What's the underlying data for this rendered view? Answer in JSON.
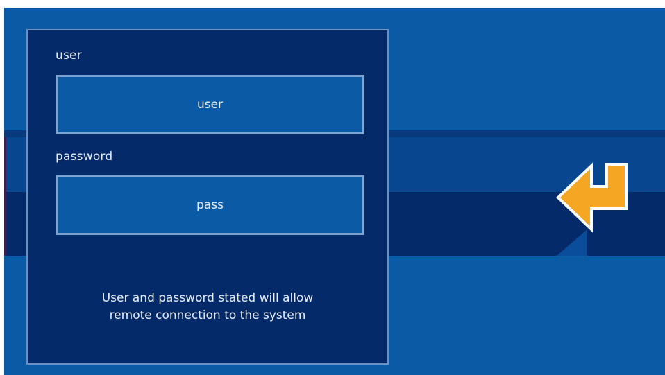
{
  "login_panel": {
    "user_label": "user",
    "user_value": "user",
    "password_label": "password",
    "password_value": "pass",
    "notice_line1": "User and password stated will allow",
    "notice_line2": "remote connection to the system"
  },
  "enter_button": {
    "icon": "enter-arrow-icon",
    "color": "#f5a623"
  },
  "colors": {
    "background": "#0b5aa6",
    "panel": "#052a6a",
    "field": "#0b5aa6",
    "field_border": "#7fa3d1",
    "text": "#e8eef8"
  }
}
